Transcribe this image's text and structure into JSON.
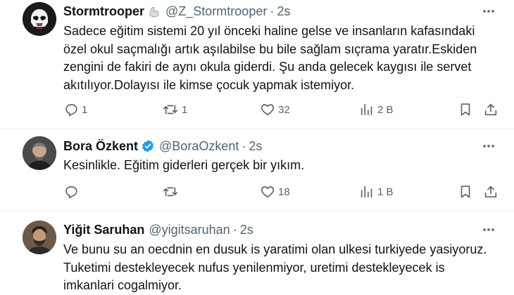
{
  "tweets": [
    {
      "display_name": "Stormtrooper",
      "badge_icon": "flexed-biceps-icon",
      "handle": "@Z_Stormtrooper",
      "separator": "·",
      "time": "2s",
      "text_lines": [
        "Sadece eğitim sistemi 20 yıl önceki haline gelse ve insanların kafasındaki",
        "özel okul saçmalığı artık aşılabilse bu bile sağlam sıçrama yaratır.Eskiden",
        "zengini de fakiri de aynı okula giderdi. Şu anda gelecek kaygısı ile servet",
        "akıtılıyor.Dolayısı ile kimse çocuk yapmak istemiyor."
      ],
      "replies": "1",
      "reposts": "1",
      "likes": "32",
      "views": "2 B"
    },
    {
      "display_name": "Bora Özkent",
      "badge_icon": "verified-badge-icon",
      "badge_color": "#1d9bf0",
      "handle": "@BoraOzkent",
      "separator": "·",
      "time": "2s",
      "text_lines": [
        "Kesinlikle. Eğitim giderleri gerçek bir yıkım."
      ],
      "replies": "",
      "reposts": "",
      "likes": "18",
      "views": "1 B"
    },
    {
      "display_name": "Yiğit Saruhan",
      "handle": "@yigitsaruhan",
      "separator": "·",
      "time": "2s",
      "text_lines": [
        "Ve bunu su an oecdnin en dusuk is yaratimi olan ulkesi turkiyede yasiyoruz.",
        "Tuketimi destekleyecek nufus yenilenmiyor, uretimi destekleyecek is",
        "imkanlari cogalmiyor."
      ]
    }
  ],
  "colors": {
    "text": "#0f1419",
    "secondary": "#536471",
    "divider": "#eff3f4",
    "verified": "#1d9bf0"
  }
}
